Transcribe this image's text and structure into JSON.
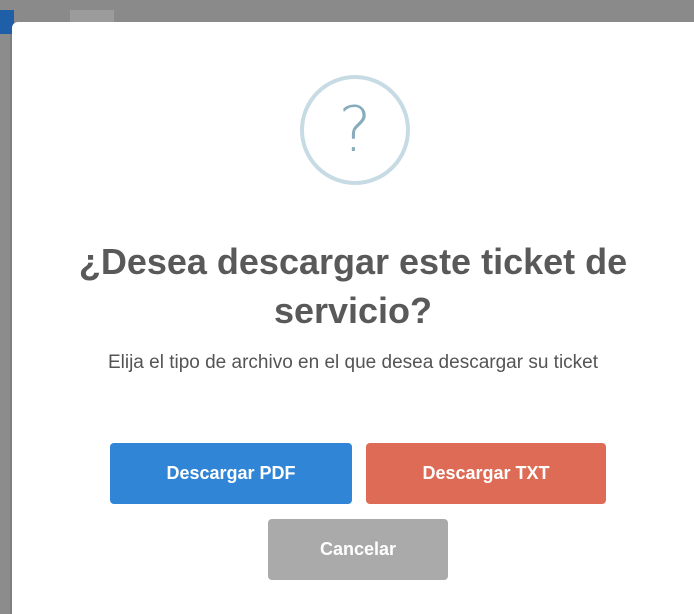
{
  "dialog": {
    "icon": "question-mark-icon",
    "icon_glyph": "?",
    "title": "¿Desea descargar este ticket de servicio?",
    "text": "Elija el tipo de archivo en el que desea descargar su ticket"
  },
  "buttons": {
    "pdf_label": "Descargar PDF",
    "txt_label": "Descargar TXT",
    "cancel_label": "Cancelar"
  },
  "colors": {
    "pdf_button": "#3085d6",
    "txt_button": "#dd6b55",
    "cancel_button": "#aaaaaa",
    "icon_ring": "#c7dbe4",
    "icon_glyph": "#87adbd"
  }
}
